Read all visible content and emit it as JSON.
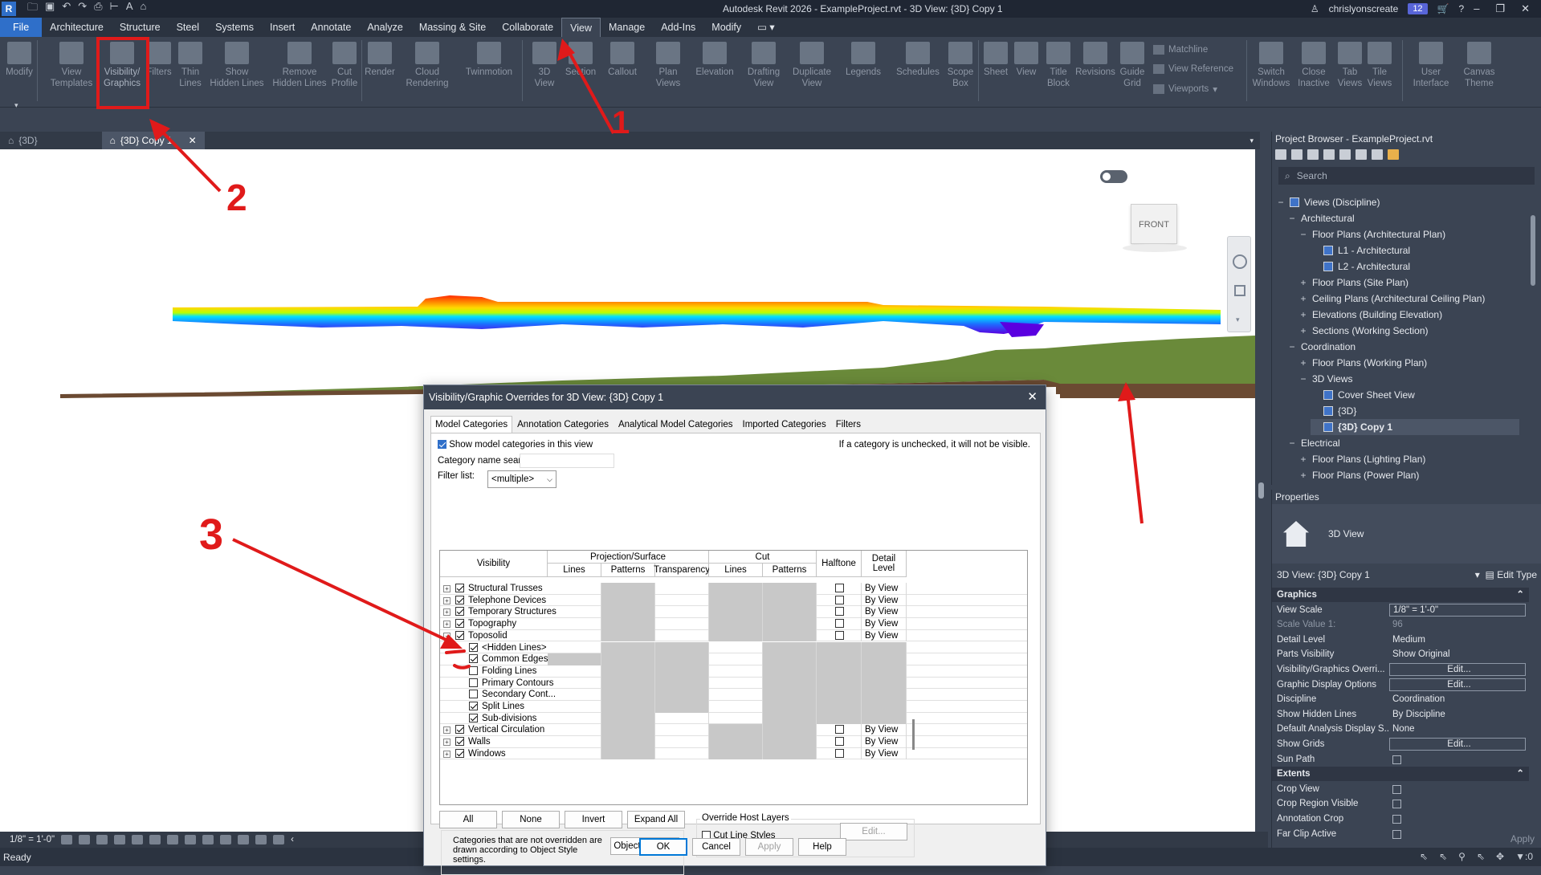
{
  "app": {
    "title": "Autodesk Revit 2026 - ExampleProject.rvt - 3D View: {3D} Copy 1",
    "logo": "R",
    "user": "chrislyonscreate",
    "notifications": "12"
  },
  "menu_tabs": [
    "File",
    "Architecture",
    "Structure",
    "Steel",
    "Systems",
    "Insert",
    "Annotate",
    "Analyze",
    "Massing & Site",
    "Collaborate",
    "View",
    "Manage",
    "Add-Ins",
    "Modify"
  ],
  "ribbon": {
    "modify": "Modify",
    "view_templates": "View\nTemplates",
    "visibility_graphics": "Visibility/\nGraphics",
    "filters": "Filters",
    "thin_lines": "Thin\nLines",
    "show_hidden_lines": "Show\nHidden Lines",
    "remove_hidden_lines": "Remove\nHidden Lines",
    "cut_profile": "Cut\nProfile",
    "render": "Render",
    "cloud_rendering": "Cloud\nRendering",
    "twinmotion": "Twinmotion",
    "view_3d": "3D\nView",
    "section": "Section",
    "callout": "Callout",
    "plan_views": "Plan\nViews",
    "elevation": "Elevation",
    "drafting_view": "Drafting\nView",
    "duplicate_view": "Duplicate\nView",
    "legends": "Legends",
    "schedules": "Schedules",
    "scope_box": "Scope\nBox",
    "sheet": "Sheet",
    "view": "View",
    "title_block": "Title\nBlock",
    "revisions": "Revisions",
    "guide_grid": "Guide\nGrid",
    "matchline": "Matchline",
    "view_reference": "View  Reference",
    "viewports": "Viewports",
    "switch_windows": "Switch\nWindows",
    "close_inactive": "Close\nInactive",
    "tab_views": "Tab\nViews",
    "tile_views": "Tile\nViews",
    "user_interface": "User\nInterface",
    "canvas_theme": "Canvas\nTheme"
  },
  "view_tabs": [
    {
      "label": "{3D}",
      "active": false
    },
    {
      "label": "{3D} Copy 1",
      "active": true
    }
  ],
  "canvas": {
    "viewcube_label": "FRONT"
  },
  "view_control_bar": {
    "scale": "1/8\" = 1'-0\""
  },
  "status": {
    "text": "Ready",
    "filter_count": ":0"
  },
  "project_browser": {
    "title": "Project Browser - ExampleProject.rvt",
    "search_placeholder": "Search",
    "tree": [
      {
        "label": "Views (Discipline)",
        "level": 0,
        "toggle": "−",
        "icon": true
      },
      {
        "label": "Architectural",
        "level": 1,
        "toggle": "−"
      },
      {
        "label": "Floor Plans (Architectural Plan)",
        "level": 2,
        "toggle": "−"
      },
      {
        "label": "L1 - Architectural",
        "level": 3,
        "toggle": "",
        "icon": true
      },
      {
        "label": "L2 - Architectural",
        "level": 3,
        "toggle": "",
        "icon": true
      },
      {
        "label": "Floor Plans (Site Plan)",
        "level": 2,
        "toggle": "+"
      },
      {
        "label": "Ceiling Plans (Architectural Ceiling Plan)",
        "level": 2,
        "toggle": "+"
      },
      {
        "label": "Elevations (Building Elevation)",
        "level": 2,
        "toggle": "+"
      },
      {
        "label": "Sections (Working Section)",
        "level": 2,
        "toggle": "+"
      },
      {
        "label": "Coordination",
        "level": 1,
        "toggle": "−"
      },
      {
        "label": "Floor Plans (Working Plan)",
        "level": 2,
        "toggle": "+"
      },
      {
        "label": "3D Views",
        "level": 2,
        "toggle": "−"
      },
      {
        "label": "Cover Sheet View",
        "level": 3,
        "toggle": "",
        "icon": true
      },
      {
        "label": "{3D}",
        "level": 3,
        "toggle": "",
        "icon": true
      },
      {
        "label": "{3D} Copy 1",
        "level": 3,
        "toggle": "",
        "icon": true,
        "selected": true
      },
      {
        "label": "Electrical",
        "level": 1,
        "toggle": "−"
      },
      {
        "label": "Floor Plans (Lighting Plan)",
        "level": 2,
        "toggle": "+"
      },
      {
        "label": "Floor Plans (Power Plan)",
        "level": 2,
        "toggle": "+"
      }
    ]
  },
  "properties": {
    "title": "Properties",
    "type_name": "3D View",
    "selection": "3D View: {3D} Copy 1",
    "edit_type": "Edit Type",
    "rows": [
      {
        "k": "Graphics",
        "section": true
      },
      {
        "k": "View Scale",
        "v": "1/8\" = 1'-0\"",
        "input": true
      },
      {
        "k": "Scale Value    1:",
        "v": "96",
        "dim": true
      },
      {
        "k": "Detail Level",
        "v": "Medium"
      },
      {
        "k": "Parts Visibility",
        "v": "Show Original"
      },
      {
        "k": "Visibility/Graphics Overri...",
        "v": "Edit...",
        "btn": true
      },
      {
        "k": "Graphic Display Options",
        "v": "Edit...",
        "btn": true
      },
      {
        "k": "Discipline",
        "v": "Coordination"
      },
      {
        "k": "Show Hidden Lines",
        "v": "By Discipline"
      },
      {
        "k": "Default Analysis Display S...",
        "v": "None"
      },
      {
        "k": "Show Grids",
        "v": "Edit...",
        "btn": true
      },
      {
        "k": "Sun Path",
        "cb": true
      },
      {
        "k": "Extents",
        "section": true
      },
      {
        "k": "Crop View",
        "cb": true
      },
      {
        "k": "Crop Region Visible",
        "cb": true
      },
      {
        "k": "Annotation Crop",
        "cb": true
      },
      {
        "k": "Far Clip Active",
        "cb": true
      }
    ],
    "apply": "Apply"
  },
  "dialog": {
    "title": "Visibility/Graphic Overrides for 3D View: {3D} Copy 1",
    "tabs": [
      "Model Categories",
      "Annotation Categories",
      "Analytical Model Categories",
      "Imported Categories",
      "Filters"
    ],
    "show_model_categories": "Show model categories in this view",
    "unchecked_note": "If a category is unchecked, it will not be visible.",
    "category_search_label": "Category name search:",
    "filter_list_label": "Filter list:",
    "filter_list_value": "<multiple>",
    "headers": {
      "visibility": "Visibility",
      "projection_surface": "Projection/Surface",
      "lines": "Lines",
      "patterns": "Patterns",
      "transparency": "Transparency",
      "cut": "Cut",
      "cut_lines": "Lines",
      "cut_patterns": "Patterns",
      "halftone": "Halftone",
      "detail_level": "Detail\nLevel"
    },
    "rows": [
      {
        "name": "Structural Trusses",
        "level": 0,
        "checked": true,
        "detail": "By View"
      },
      {
        "name": "Telephone Devices",
        "level": 0,
        "checked": true,
        "detail": "By View"
      },
      {
        "name": "Temporary Structures",
        "level": 0,
        "checked": true,
        "detail": "By View"
      },
      {
        "name": "Topography",
        "level": 0,
        "checked": true,
        "detail": "By View"
      },
      {
        "name": "Toposolid",
        "level": 0,
        "checked": true,
        "detail": "By View",
        "expanded": true
      },
      {
        "name": "<Hidden Lines>",
        "level": 1,
        "checked": true
      },
      {
        "name": "Common Edges",
        "level": 1,
        "checked": true
      },
      {
        "name": "Folding Lines",
        "level": 1,
        "checked": false
      },
      {
        "name": "Primary Contours",
        "level": 1,
        "checked": false
      },
      {
        "name": "Secondary Cont...",
        "level": 1,
        "checked": false
      },
      {
        "name": "Split Lines",
        "level": 1,
        "checked": true
      },
      {
        "name": "Sub-divisions",
        "level": 1,
        "checked": true
      },
      {
        "name": "Vertical Circulation",
        "level": 0,
        "checked": true,
        "detail": "By View"
      },
      {
        "name": "Walls",
        "level": 0,
        "checked": true,
        "detail": "By View"
      },
      {
        "name": "Windows",
        "level": 0,
        "checked": true,
        "detail": "By View"
      }
    ],
    "buttons": {
      "all": "All",
      "none": "None",
      "invert": "Invert",
      "expand_all": "Expand All",
      "object_styles": "Object Styles...",
      "ok": "OK",
      "cancel": "Cancel",
      "apply": "Apply",
      "help": "Help",
      "edit": "Edit..."
    },
    "override_host_layers": "Override Host Layers",
    "cut_line_styles": "Cut Line Styles",
    "object_styles_note": "Categories that are not overridden are drawn according to Object Style settings."
  },
  "annotations": [
    "1",
    "2",
    "3"
  ],
  "colors": {
    "annotation": "#e01a1a",
    "accent": "#2f6fc9",
    "terrain_green": "#6a8a3a",
    "terrain_brown": "#6b4a32"
  }
}
